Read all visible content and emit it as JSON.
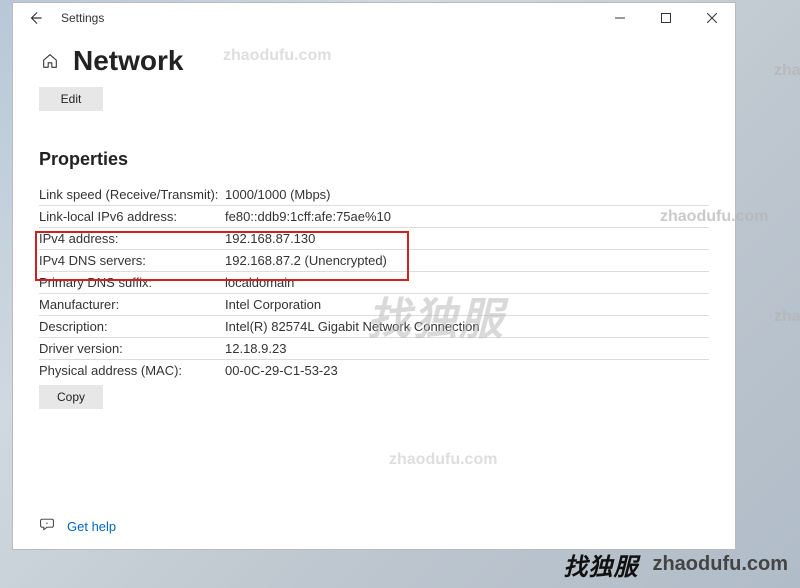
{
  "window": {
    "title": "Settings"
  },
  "page": {
    "title": "Network",
    "edit_label": "Edit",
    "section_title": "Properties",
    "copy_label": "Copy",
    "help_label": "Get help"
  },
  "properties": [
    {
      "label": "Link speed (Receive/Transmit):",
      "value": "1000/1000 (Mbps)"
    },
    {
      "label": "Link-local IPv6 address:",
      "value": "fe80::ddb9:1cff:afe:75ae%10"
    },
    {
      "label": "IPv4 address:",
      "value": "192.168.87.130"
    },
    {
      "label": "IPv4 DNS servers:",
      "value": "192.168.87.2 (Unencrypted)"
    },
    {
      "label": "Primary DNS suffix:",
      "value": "localdomain"
    },
    {
      "label": "Manufacturer:",
      "value": "Intel Corporation"
    },
    {
      "label": "Description:",
      "value": "Intel(R) 82574L Gigabit Network Connection"
    },
    {
      "label": "Driver version:",
      "value": "12.18.9.23"
    },
    {
      "label": "Physical address (MAC):",
      "value": "00-0C-29-C1-53-23"
    }
  ],
  "watermarks": {
    "url": "zhaodufu.com",
    "cjk": "找独服"
  }
}
